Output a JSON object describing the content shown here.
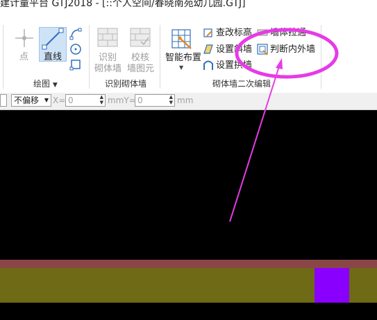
{
  "window": {
    "title": "建计量平台 GTJ2018 - [::个人空间/春晓南苑幼儿园.GTJ]"
  },
  "ribbon": {
    "draw_group": {
      "label": "绘图",
      "point_label": "点",
      "line_label": "直线"
    },
    "recognize_group": {
      "label": "识别砌体墙",
      "recognize_line1": "识别",
      "recognize_line2": "砌体墙",
      "verify_line1": "校核",
      "verify_line2": "墙图元"
    },
    "edit_group": {
      "label": "砌体墙二次编辑",
      "smart_layout": "智能布置",
      "check_elevation": "查改标高",
      "set_slope": "设置斜墙",
      "set_arch": "设置拱墙",
      "wall_extend": "墙体拉通",
      "judge_in_out": "判断内外墙"
    }
  },
  "coordbar": {
    "offset_value": "不偏移",
    "x_label": "X=",
    "x_value": "0",
    "mid_unit": "mmY=",
    "y_value": "0",
    "end_unit": "mm"
  },
  "colors": {
    "canvas": "#000000",
    "wall_top": "#8a4646",
    "wall_body": "#6e6a16",
    "column": "#8a00ff",
    "annotation": "#e63be6",
    "selected": "#cfe3f7"
  }
}
